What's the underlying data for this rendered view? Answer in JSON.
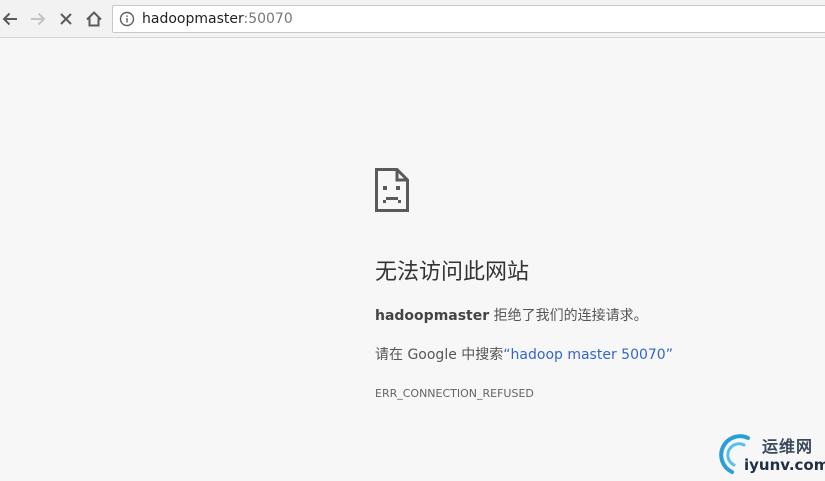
{
  "browser": {
    "url_host": "hadoopmaster",
    "url_port": ":50070"
  },
  "error_page": {
    "heading": "无法访问此网站",
    "host": "hadoopmaster",
    "refused_text": " 拒绝了我们的连接请求。",
    "search_prefix": "请在 Google 中搜索",
    "search_link": "“hadoop master 50070”",
    "error_code": "ERR_CONNECTION_REFUSED"
  },
  "watermark": {
    "chinese": "运维网",
    "english": "iyunv.com"
  },
  "icons": {
    "back": "arrow-left-icon",
    "forward": "arrow-right-icon",
    "stop": "close-icon",
    "home": "home-icon",
    "info": "info-icon",
    "sad_page": "sad-page-icon"
  },
  "colors": {
    "link": "#3367c7",
    "page_background": "#f7f7f7"
  }
}
